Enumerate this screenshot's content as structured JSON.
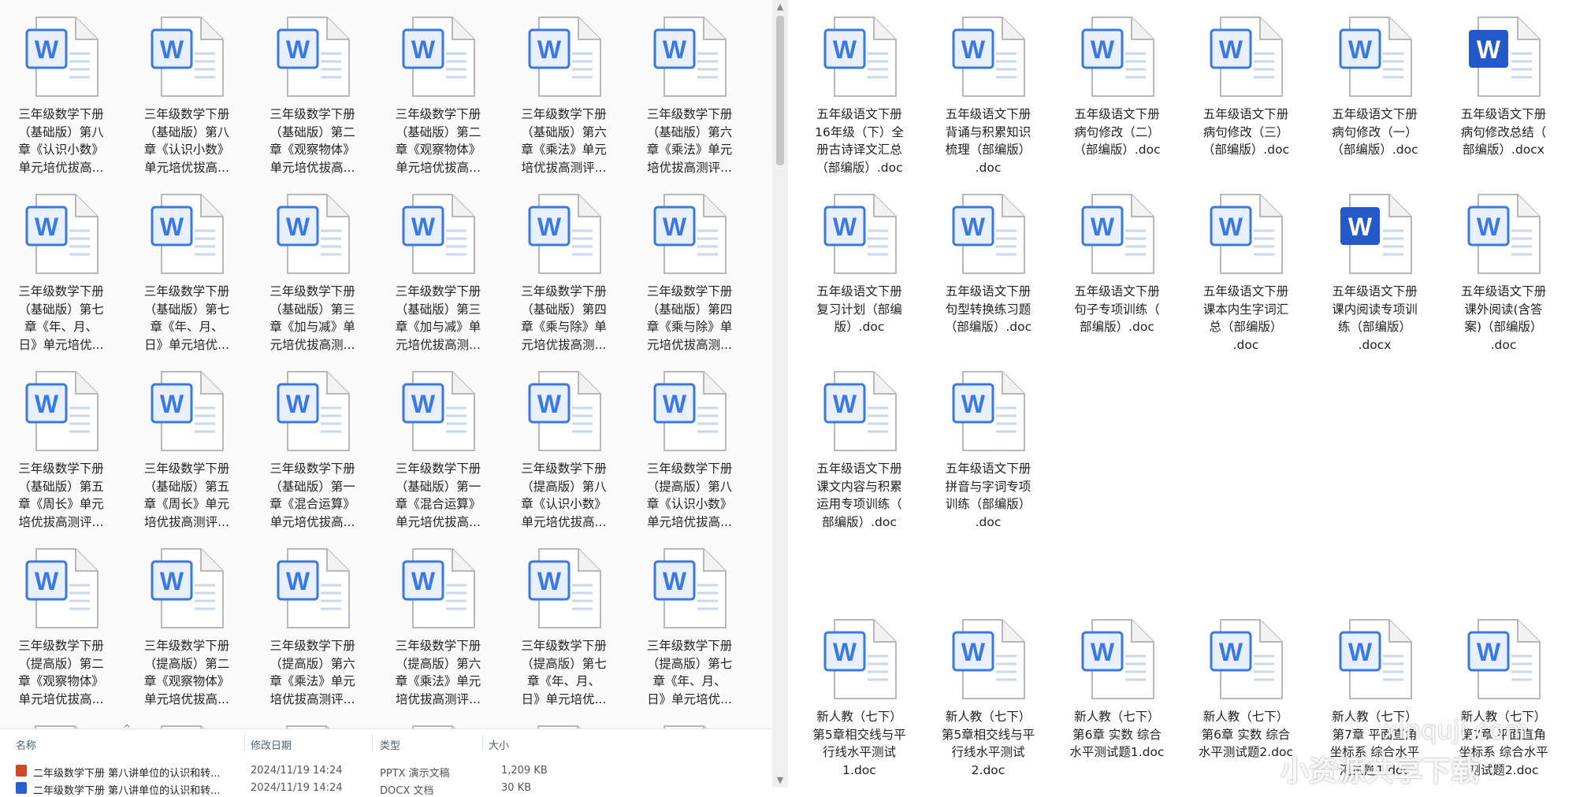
{
  "left_files": [
    [
      "三年级数学下册",
      "（基础版）第八",
      "章《认识小数》",
      "单元培优拔高..."
    ],
    [
      "三年级数学下册",
      "（基础版）第八",
      "章《认识小数》",
      "单元培优拔高..."
    ],
    [
      "三年级数学下册",
      "（基础版）第二",
      "章《观察物体》",
      "单元培优拔高..."
    ],
    [
      "三年级数学下册",
      "（基础版）第二",
      "章《观察物体》",
      "单元培优拔高..."
    ],
    [
      "三年级数学下册",
      "（基础版）第六",
      "章《乘法》单元",
      "培优拔高测评..."
    ],
    [
      "三年级数学下册",
      "（基础版）第六",
      "章《乘法》单元",
      "培优拔高测评..."
    ],
    [
      "三年级数学下册",
      "（基础版）第七",
      "章《年、月、",
      "日》单元培优..."
    ],
    [
      "三年级数学下册",
      "（基础版）第七",
      "章《年、月、",
      "日》单元培优..."
    ],
    [
      "三年级数学下册",
      "（基础版）第三",
      "章《加与减》单",
      "元培优拔高测..."
    ],
    [
      "三年级数学下册",
      "（基础版）第三",
      "章《加与减》单",
      "元培优拔高测..."
    ],
    [
      "三年级数学下册",
      "（基础版）第四",
      "章《乘与除》单",
      "元培优拔高测..."
    ],
    [
      "三年级数学下册",
      "（基础版）第四",
      "章《乘与除》单",
      "元培优拔高测..."
    ],
    [
      "三年级数学下册",
      "（基础版）第五",
      "章《周长》单元",
      "培优拔高测评..."
    ],
    [
      "三年级数学下册",
      "（基础版）第五",
      "章《周长》单元",
      "培优拔高测评..."
    ],
    [
      "三年级数学下册",
      "（基础版）第一",
      "章《混合运算》",
      "单元培优拔高..."
    ],
    [
      "三年级数学下册",
      "（基础版）第一",
      "章《混合运算》",
      "单元培优拔高..."
    ],
    [
      "三年级数学下册",
      "（提高版）第八",
      "章《认识小数》",
      "单元培优拔高..."
    ],
    [
      "三年级数学下册",
      "（提高版）第八",
      "章《认识小数》",
      "单元培优拔高..."
    ],
    [
      "三年级数学下册",
      "（提高版）第二",
      "章《观察物体》",
      "单元培优拔高..."
    ],
    [
      "三年级数学下册",
      "（提高版）第二",
      "章《观察物体》",
      "单元培优拔高..."
    ],
    [
      "三年级数学下册",
      "（提高版）第六",
      "章《乘法》单元",
      "培优拔高测评..."
    ],
    [
      "三年级数学下册",
      "（提高版）第六",
      "章《乘法》单元",
      "培优拔高测评..."
    ],
    [
      "三年级数学下册",
      "（提高版）第七",
      "章《年、月、",
      "日》单元培优..."
    ],
    [
      "三年级数学下册",
      "（提高版）第七",
      "章《年、月、",
      "日》单元培优..."
    ]
  ],
  "right_files": [
    {
      "lines": [
        "五年级语文下册",
        "16年级（下）全",
        "册古诗译文汇总",
        "（部编版）.doc"
      ],
      "highlight": false
    },
    {
      "lines": [
        "五年级语文下册",
        "背诵与积累知识",
        "梳理（部编版）",
        ".doc"
      ],
      "highlight": false
    },
    {
      "lines": [
        "五年级语文下册",
        "病句修改（二）",
        "（部编版）.doc"
      ],
      "highlight": false
    },
    {
      "lines": [
        "五年级语文下册",
        "病句修改（三）",
        "（部编版）.doc"
      ],
      "highlight": false
    },
    {
      "lines": [
        "五年级语文下册",
        "病句修改（一）",
        "（部编版）.doc"
      ],
      "highlight": false
    },
    {
      "lines": [
        "五年级语文下册",
        "病句修改总结（",
        "部编版）.docx"
      ],
      "highlight": true
    },
    {
      "lines": [
        "五年级语文下册",
        "复习计划（部编",
        "版）.doc"
      ],
      "highlight": false
    },
    {
      "lines": [
        "五年级语文下册",
        "句型转换练习题",
        "（部编版）.doc"
      ],
      "highlight": false
    },
    {
      "lines": [
        "五年级语文下册",
        "句子专项训练（",
        "部编版）.doc"
      ],
      "highlight": false
    },
    {
      "lines": [
        "五年级语文下册",
        "课本内生字词汇",
        "总（部编版）",
        ".doc"
      ],
      "highlight": false
    },
    {
      "lines": [
        "五年级语文下册",
        "课内阅读专项训",
        "练（部编版）",
        ".docx"
      ],
      "highlight": true
    },
    {
      "lines": [
        "五年级语文下册",
        "课外阅读(含答",
        "案)（部编版）",
        ".doc"
      ],
      "highlight": false
    },
    {
      "lines": [
        "五年级语文下册",
        "课文内容与积累",
        "运用专项训练（",
        "部编版）.doc"
      ],
      "highlight": false
    },
    {
      "lines": [
        "五年级语文下册",
        "拼音与字词专项",
        "训练（部编版）",
        ".doc"
      ],
      "highlight": false
    }
  ],
  "right_bottom_files": [
    [
      "新人教（七下）",
      "第5章相交线与平",
      "行线水平测试",
      "1.doc"
    ],
    [
      "新人教（七下）",
      "第5章相交线与平",
      "行线水平测试",
      "2.doc"
    ],
    [
      "新人教（七下）",
      "第6章 实数 综合",
      "水平测试题1.doc"
    ],
    [
      "新人教（七下）",
      "第6章 实数 综合",
      "水平测试题2.doc"
    ],
    [
      "新人教（七下）",
      "第7章 平面直角",
      "坐标系 综合水平",
      "测试题1.doc"
    ],
    [
      "新人教（七下）",
      "第7章 平面直角",
      "坐标系 综合水平",
      "测试题2.doc"
    ]
  ],
  "icon_letter": "W",
  "details": {
    "headers": {
      "name": "名称",
      "modified": "修改日期",
      "type": "类型",
      "size": "大小"
    },
    "rows": [
      {
        "name": "二年级数学下册 第八讲单位的认识和转...",
        "modified": "2024/11/19 14:24",
        "type": "PPTX 演示文稿",
        "size": "1,209 KB",
        "icon": "ppt"
      },
      {
        "name": "二年级数学下册 第八讲单位的认识和转...",
        "modified": "2024/11/19 14:24",
        "type": "DOCX 文档",
        "size": "30 KB",
        "icon": "docx"
      }
    ]
  },
  "watermark": {
    "url": "xinquji.com",
    "text": "小资源共享下载"
  },
  "colors": {
    "word_blue": "#3b78e7",
    "word_dark": "#2359c9",
    "ppt_orange": "#d24726"
  }
}
